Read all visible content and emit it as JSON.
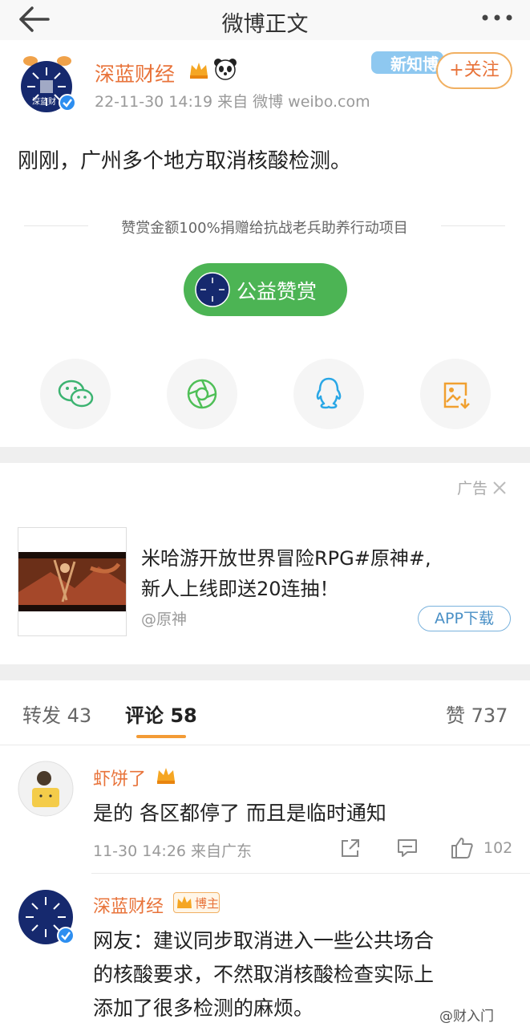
{
  "header": {
    "title": "微博正文"
  },
  "post": {
    "author": "深蓝财经",
    "avatar_label": "深蓝财",
    "meta": "22-11-30 14:19   来自 微博 weibo.com",
    "banner": "新知博",
    "follow_label": "+关注",
    "text": "刚刚，广州多个地方取消核酸检测。"
  },
  "reward": {
    "note": "赞赏金额100%捐赠给抗战老兵助养行动项目",
    "button": "公益赞赏",
    "button_color": "#4cb454"
  },
  "share": {
    "icons": [
      "wechat-icon",
      "moments-icon",
      "qq-icon",
      "save-image-icon"
    ]
  },
  "ad": {
    "label": "广告",
    "line1": "米哈游开放世界冒险RPG#原神#,",
    "line2": "新人上线即送20连抽！",
    "handle": "@原神",
    "button": "APP下载"
  },
  "tabs": {
    "repost": "转发 43",
    "comments": "评论 58",
    "likes": "赞 737"
  },
  "comments": [
    {
      "name": "虾饼了",
      "text": "是的 各区都停了 而且是临时通知",
      "meta": "11-30 14:26  来自广东",
      "likes": "102"
    },
    {
      "name": "深蓝财经",
      "badge": "博主",
      "lines": [
        "网友：建议同步取消进入一些公共场合",
        "的核酸要求，不然取消核酸检查实际上",
        "添加了很多检测的麻烦。"
      ]
    }
  ],
  "watermark": "@财入门",
  "colors": {
    "accent_orange": "#e8733a",
    "tab_underline": "#f39b35",
    "link_blue": "#4a90c6"
  }
}
